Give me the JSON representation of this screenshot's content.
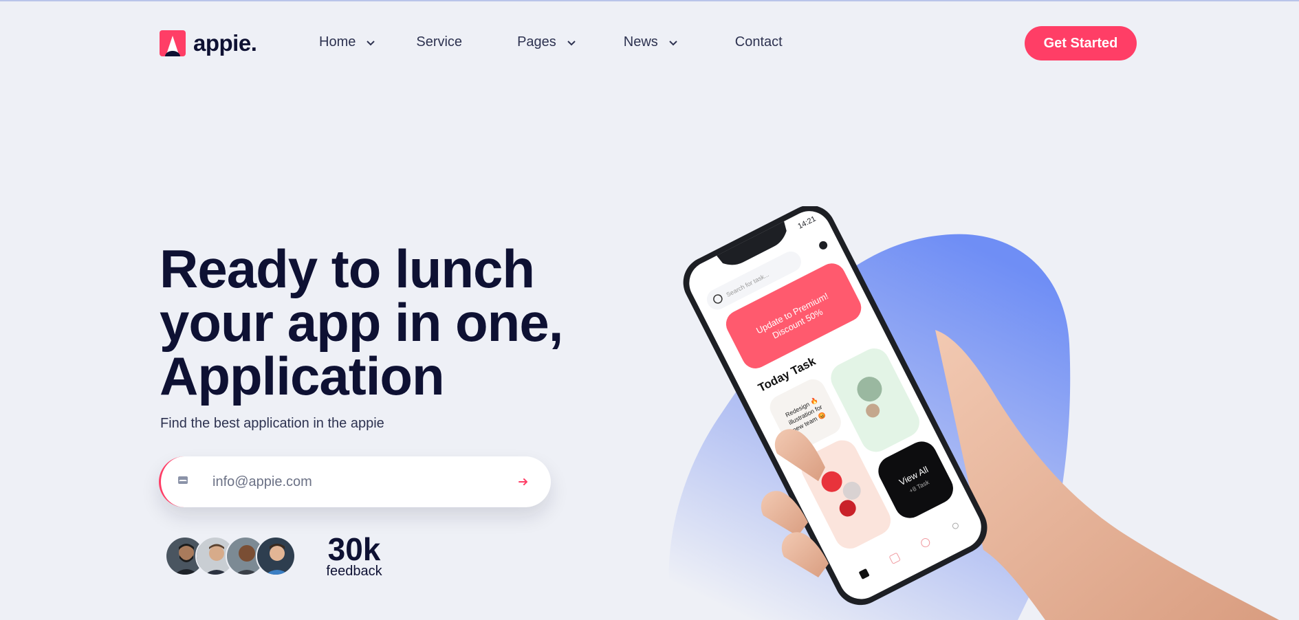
{
  "brand": {
    "name": "appie.",
    "accent": "#ff3e66",
    "dark": "#0e1133"
  },
  "nav": {
    "items": [
      {
        "label": "Home",
        "has_dropdown": true
      },
      {
        "label": "Service",
        "has_dropdown": false
      },
      {
        "label": "Pages",
        "has_dropdown": true
      },
      {
        "label": "News",
        "has_dropdown": true
      },
      {
        "label": "Contact",
        "has_dropdown": false
      }
    ],
    "cta_label": "Get Started"
  },
  "hero": {
    "headline_line1": "Ready to lunch",
    "headline_line2": "your app in one,",
    "headline_line3": "Application",
    "subtitle": "Find the best application in the appie",
    "email_placeholder": "info@appie.com",
    "email_icon": "envelope-icon",
    "submit_icon": "arrow-right-icon",
    "feedback_count": "30k",
    "feedback_label": "feedback"
  },
  "phone_screen": {
    "time": "14:21",
    "search_placeholder": "Search for task...",
    "promo_text": "Update to Premium! Discount 50%",
    "section_title": "Today Task",
    "task_text": "Redesign 🔥 illustration for new team 😡",
    "view_all": "View All",
    "view_all_sub": "+8 Task"
  }
}
